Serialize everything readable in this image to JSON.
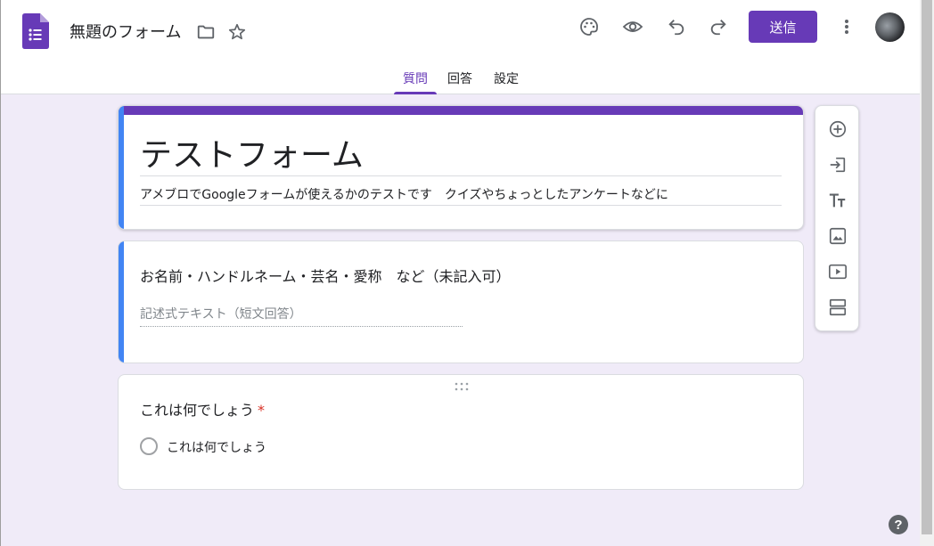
{
  "header": {
    "doc_title": "無題のフォーム",
    "send_label": "送信"
  },
  "tabs": [
    {
      "label": "質問",
      "active": true
    },
    {
      "label": "回答",
      "active": false
    },
    {
      "label": "設定",
      "active": false
    }
  ],
  "form": {
    "title": "テストフォーム",
    "description": "アメブロでGoogleフォームが使えるかのテストです　クイズやちょっとしたアンケートなどに"
  },
  "questions": [
    {
      "title": "お名前・ハンドルネーム・芸名・愛称　など（未記入可）",
      "answer_placeholder": "記述式テキスト（短文回答）",
      "required": false
    },
    {
      "title": "これは何でしょう",
      "required_mark": "*",
      "option_label": "これは何でしょう"
    }
  ],
  "help_label": "?",
  "colors": {
    "accent": "#673ab7",
    "background": "#f0ebf8",
    "focus_bar": "#4285f4",
    "required": "#d93025"
  },
  "icons": {
    "header": [
      "forms-logo",
      "folder-icon",
      "star-icon",
      "palette-icon",
      "eye-icon",
      "undo-icon",
      "redo-icon",
      "more-vert-icon"
    ],
    "toolbar": [
      "add-question-icon",
      "import-questions-icon",
      "add-title-icon",
      "add-image-icon",
      "add-video-icon",
      "add-section-icon"
    ]
  }
}
